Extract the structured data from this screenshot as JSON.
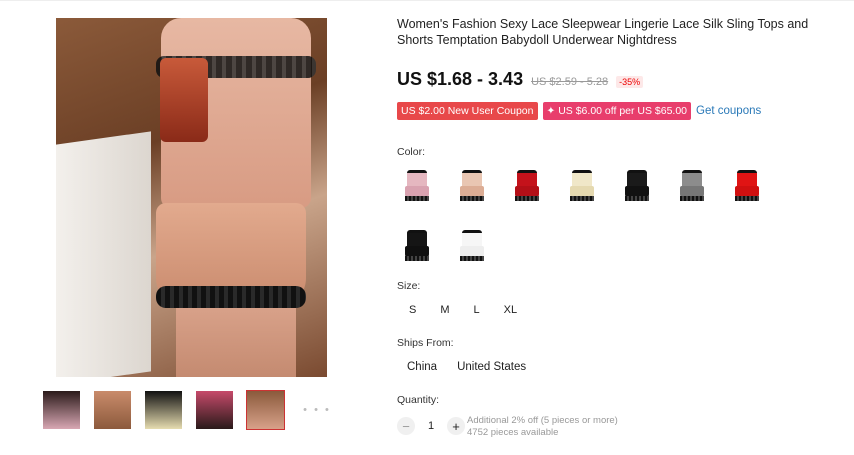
{
  "product": {
    "title": "Women's Fashion Sexy Lace Sleepwear Lingerie Lace Silk Sling Tops and Shorts Temptation Babydoll Underwear Nightdress",
    "price": "US $1.68 - 3.43",
    "original_price": "US $2.59 - 5.28",
    "discount": "-35%"
  },
  "coupons": {
    "new_user": "US $2.00 New User Coupon",
    "store": "✦ US $6.00 off per US $65.00",
    "link": "Get coupons"
  },
  "color": {
    "label": "Color:",
    "swatches": [
      {
        "name": "pink-black",
        "top": "#e5b7c0",
        "shorts": "#d9a2b0"
      },
      {
        "name": "nude",
        "top": "#e9c6b2",
        "shorts": "#dcad95"
      },
      {
        "name": "red",
        "top": "#c4121b",
        "shorts": "#b30f17"
      },
      {
        "name": "champagne",
        "top": "#f0e7c8",
        "shorts": "#e5d9b0"
      },
      {
        "name": "black",
        "top": "#1a1a1a",
        "shorts": "#111111"
      },
      {
        "name": "grey",
        "top": "#8c8c8c",
        "shorts": "#777777"
      },
      {
        "name": "bright-red",
        "top": "#e01414",
        "shorts": "#d01010"
      },
      {
        "name": "black-white",
        "top": "#151515",
        "shorts": "#101010"
      },
      {
        "name": "white",
        "top": "#f6f6f6",
        "shorts": "#eeeeee"
      }
    ]
  },
  "size": {
    "label": "Size:",
    "options": [
      "S",
      "M",
      "L",
      "XL"
    ]
  },
  "ships": {
    "label": "Ships From:",
    "options": [
      "China",
      "United States"
    ]
  },
  "quantity": {
    "label": "Quantity:",
    "minus": "−",
    "value": "1",
    "plus": "+",
    "note": "Additional 2% off (5 pieces or more)",
    "available": "4752 pieces available"
  },
  "gallery": {
    "thumbnails": [
      {
        "top": "#2a1a1a",
        "bottom": "#d8a7b3"
      },
      {
        "top": "#c98b6b",
        "bottom": "#8c5a3c"
      },
      {
        "top": "#111111",
        "bottom": "#e6dcb0"
      },
      {
        "top": "#c64a6a",
        "bottom": "#2a1a1a"
      },
      {
        "top": "#8a5a3c",
        "bottom": "#d8a189"
      }
    ],
    "more": "• • •"
  }
}
